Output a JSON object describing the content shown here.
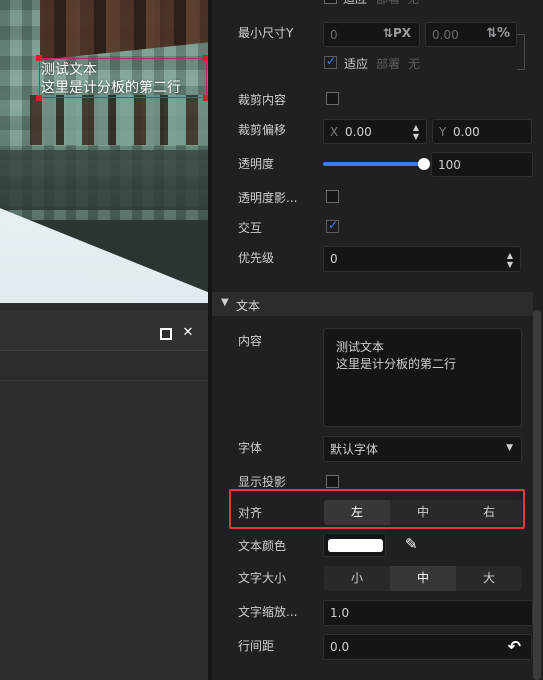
{
  "viewport": {
    "text_line1": "测试文本",
    "text_line2": "这里是计分板的第二行"
  },
  "inspector": {
    "top_partial": {
      "checkbox_label": "适应",
      "disabled_label": "部署",
      "disabled_value": "无"
    },
    "min_size_y": {
      "label": "最小尺寸Y",
      "value1": "0",
      "unit1": "PX",
      "value2": "0.00",
      "unit2": "%"
    },
    "adapt": {
      "label": "适应",
      "disabled_label": "部署",
      "disabled_value": "无"
    },
    "clip_content": {
      "label": "裁剪内容"
    },
    "clip_offset": {
      "label": "裁剪偏移",
      "x_prefix": "X",
      "x_value": "0.00",
      "y_prefix": "Y",
      "y_value": "0.00"
    },
    "opacity": {
      "label": "透明度",
      "value": "100",
      "slider_fraction": 0.95
    },
    "opacity_affect": {
      "label": "透明度影..."
    },
    "interact": {
      "label": "交互"
    },
    "priority": {
      "label": "优先级",
      "value": "0"
    },
    "section": {
      "title": "文本"
    },
    "content": {
      "label": "内容",
      "line1": "测试文本",
      "line2": "这里是计分板的第二行"
    },
    "font": {
      "label": "字体",
      "value": "默认字体"
    },
    "shadow": {
      "label": "显示投影"
    },
    "align": {
      "label": "对齐",
      "options": [
        "左",
        "中",
        "右"
      ],
      "selected": "左"
    },
    "text_color": {
      "label": "文本颜色",
      "color": "#ffffff"
    },
    "text_size": {
      "label": "文字大小",
      "options": [
        "小",
        "中",
        "大"
      ],
      "selected": "中"
    },
    "text_scale": {
      "label": "文字缩放...",
      "value": "1.0"
    },
    "line_spacing": {
      "label": "行间距",
      "value": "0.0"
    }
  },
  "colors": {
    "accent": "#3a7cf0",
    "highlight": "#e03a3a",
    "selection": "#b02a7a"
  }
}
